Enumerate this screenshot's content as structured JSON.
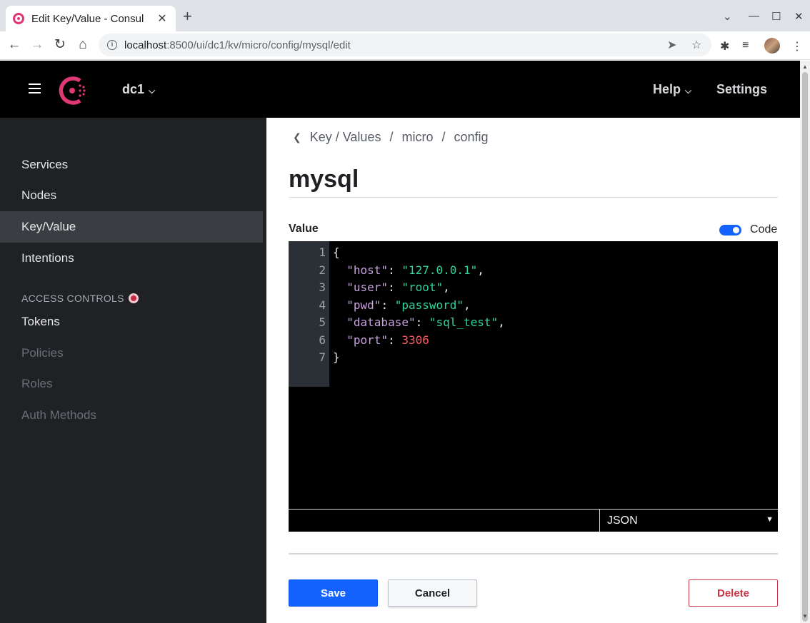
{
  "browser": {
    "tab_title": "Edit Key/Value - Consul",
    "tab_close": "✕",
    "new_tab": "+",
    "url_host": "localhost",
    "url_rest": ":8500/ui/dc1/kv/micro/config/mysql/edit"
  },
  "header": {
    "datacenter": "dc1",
    "help": "Help",
    "settings": "Settings"
  },
  "sidebar": {
    "items": [
      {
        "label": "Services"
      },
      {
        "label": "Nodes"
      },
      {
        "label": "Key/Value"
      },
      {
        "label": "Intentions"
      }
    ],
    "section_title": "ACCESS CONTROLS",
    "acl_items": [
      {
        "label": "Tokens"
      },
      {
        "label": "Policies"
      },
      {
        "label": "Roles"
      },
      {
        "label": "Auth Methods"
      }
    ]
  },
  "breadcrumb": {
    "root": "Key / Values",
    "items": [
      "micro",
      "config"
    ],
    "separator": "/"
  },
  "page": {
    "title": "mysql",
    "value_label": "Value",
    "code_toggle_label": "Code",
    "code_toggle_on": true
  },
  "editor": {
    "line_numbers": [
      "1",
      "2",
      "3",
      "4",
      "5",
      "6",
      "7"
    ],
    "lines": [
      {
        "parts": [
          {
            "t": "{",
            "c": "p"
          }
        ]
      },
      {
        "parts": [
          {
            "t": "  ",
            "c": "p"
          },
          {
            "t": "\"host\"",
            "c": "k"
          },
          {
            "t": ": ",
            "c": "p"
          },
          {
            "t": "\"127.0.0.1\"",
            "c": "s"
          },
          {
            "t": ",",
            "c": "p"
          }
        ]
      },
      {
        "parts": [
          {
            "t": "  ",
            "c": "p"
          },
          {
            "t": "\"user\"",
            "c": "k"
          },
          {
            "t": ": ",
            "c": "p"
          },
          {
            "t": "\"root\"",
            "c": "s"
          },
          {
            "t": ",",
            "c": "p"
          }
        ]
      },
      {
        "parts": [
          {
            "t": "  ",
            "c": "p"
          },
          {
            "t": "\"pwd\"",
            "c": "k"
          },
          {
            "t": ": ",
            "c": "p"
          },
          {
            "t": "\"password\"",
            "c": "s"
          },
          {
            "t": ",",
            "c": "p"
          }
        ]
      },
      {
        "parts": [
          {
            "t": "  ",
            "c": "p"
          },
          {
            "t": "\"database\"",
            "c": "k"
          },
          {
            "t": ": ",
            "c": "p"
          },
          {
            "t": "\"sql_test\"",
            "c": "s"
          },
          {
            "t": ",",
            "c": "p"
          }
        ]
      },
      {
        "parts": [
          {
            "t": "  ",
            "c": "p"
          },
          {
            "t": "\"port\"",
            "c": "k"
          },
          {
            "t": ": ",
            "c": "p"
          },
          {
            "t": "3306",
            "c": "n"
          }
        ]
      },
      {
        "parts": [
          {
            "t": "}",
            "c": "p"
          }
        ]
      }
    ],
    "mode": "JSON"
  },
  "actions": {
    "save": "Save",
    "cancel": "Cancel",
    "delete": "Delete"
  },
  "colors": {
    "primary": "#1563ff",
    "danger": "#c73445",
    "brand": "#e03875"
  }
}
